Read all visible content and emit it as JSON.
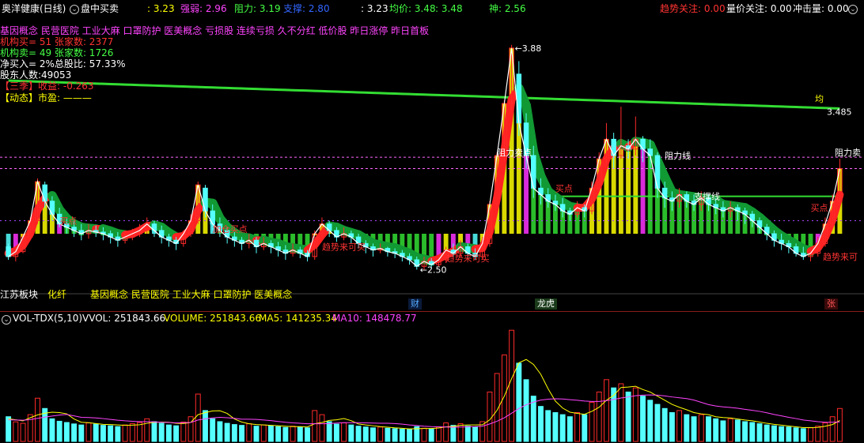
{
  "topbar": {
    "title": "奥洋健康(日线)",
    "menu_label": "盘中买卖",
    "price1": ": 3.23",
    "strength_label": "强弱: 2.96",
    "resistance_label": "阻力: 3.19",
    "support_label": "支撑: 2.80",
    "price2": ": 3.23",
    "avg_label": "均价: 3.48",
    "avg_value": ": 3.48",
    "god_label": "神: 2.56",
    "trend_label": "趋势关注: 0.00",
    "volume_price_label": "量价关注: 0.00",
    "impact_label": "冲击量: 0.00"
  },
  "colors": {
    "background": "#000000",
    "up": "#ff2a2a",
    "down": "#55ffff",
    "green_band": "#33dd33",
    "yellow": "#ffff00",
    "magenta": "#ff33ff",
    "white": "#ffffff"
  },
  "info_lines": {
    "concepts": "基因概念 民营医院 工业大麻 口罩防护 医美概念 亏损股 连续亏损 久不分红 低价股 昨日涨停 昨日首板",
    "inst_buy": "机构买= 51 张家数:  2377",
    "inst_sell": "机构卖= 49 张家数:  1726",
    "net_buy": "净买入= 2%总股比: 57.33%",
    "holders": "股东人数:49053",
    "three_season": "【三季】收益: -0.263",
    "dynamic": "【动态】市盈: ———"
  },
  "chart_labels": {
    "high_price": "3.88",
    "low_price": "2.50",
    "avg_right": "均",
    "avg_value": "3.485",
    "resistance_sell": "阻力卖",
    "resist_point": "阻力卖点",
    "pressure_line": "阻力线",
    "support_line": "支撑线",
    "trend_buy_1": "趋势来可买",
    "trend_buy_2": "趋势来可买",
    "trend_buy_3": "趋势来可",
    "buy_point_1": "买点",
    "buy_point_2": "买点",
    "red_buy": "加仓买点",
    "sell_tag": "买点"
  },
  "bottom_info": {
    "sector": "江苏板块",
    "industry": "化纤",
    "concepts": "基因概念 民营医院 工业大麻 口罩防护 医美概念"
  },
  "markers": [
    {
      "label": "财",
      "color": "#55aaff"
    },
    {
      "label": "龙虎",
      "color": "#ffffff"
    },
    {
      "label": "张",
      "color": "#ff5555"
    }
  ],
  "volume": {
    "indicator": "VOL-TDX(5,10)",
    "vvol": "VVOL: 251843.66",
    "volume": "VOLUME: 251843.66",
    "ma5": "MA5: 141235.34",
    "ma10": "MA10: 148478.77"
  },
  "chart_data": {
    "type": "candlestick",
    "candles": [
      [
        2.64,
        2.58,
        2.66,
        2.56
      ],
      [
        2.58,
        2.61,
        2.64,
        2.55
      ],
      [
        2.61,
        2.7,
        2.72,
        2.6
      ],
      [
        2.7,
        2.8,
        2.82,
        2.68
      ],
      [
        2.8,
        3.04,
        3.06,
        2.78
      ],
      [
        3.02,
        2.92,
        3.04,
        2.88
      ],
      [
        2.92,
        2.84,
        2.95,
        2.8
      ],
      [
        2.84,
        2.78,
        2.88,
        2.76
      ],
      [
        2.78,
        2.76,
        2.82,
        2.72
      ],
      [
        2.76,
        2.74,
        2.8,
        2.7
      ],
      [
        2.74,
        2.72,
        2.78,
        2.68
      ],
      [
        2.72,
        2.74,
        2.78,
        2.69
      ],
      [
        2.74,
        2.73,
        2.77,
        2.7
      ],
      [
        2.73,
        2.72,
        2.76,
        2.68
      ],
      [
        2.72,
        2.7,
        2.74,
        2.66
      ],
      [
        2.7,
        2.68,
        2.73,
        2.64
      ],
      [
        2.68,
        2.7,
        2.74,
        2.66
      ],
      [
        2.7,
        2.72,
        2.75,
        2.68
      ],
      [
        2.72,
        2.74,
        2.78,
        2.7
      ],
      [
        2.74,
        2.78,
        2.82,
        2.72
      ],
      [
        2.78,
        2.74,
        2.8,
        2.7
      ],
      [
        2.74,
        2.7,
        2.77,
        2.66
      ],
      [
        2.7,
        2.68,
        2.72,
        2.64
      ],
      [
        2.68,
        2.66,
        2.7,
        2.62
      ],
      [
        2.66,
        2.72,
        2.74,
        2.64
      ],
      [
        2.72,
        2.8,
        2.84,
        2.7
      ],
      [
        2.8,
        3.02,
        3.04,
        2.78
      ],
      [
        3.0,
        2.86,
        3.02,
        2.82
      ],
      [
        2.86,
        2.78,
        2.9,
        2.74
      ],
      [
        2.78,
        2.74,
        2.82,
        2.7
      ],
      [
        2.74,
        2.7,
        2.76,
        2.66
      ],
      [
        2.7,
        2.68,
        2.73,
        2.64
      ],
      [
        2.68,
        2.66,
        2.7,
        2.62
      ],
      [
        2.66,
        2.68,
        2.72,
        2.63
      ],
      [
        2.68,
        2.64,
        2.7,
        2.6
      ],
      [
        2.64,
        2.66,
        2.7,
        2.62
      ],
      [
        2.66,
        2.64,
        2.68,
        2.6
      ],
      [
        2.64,
        2.62,
        2.67,
        2.58
      ],
      [
        2.62,
        2.6,
        2.65,
        2.56
      ],
      [
        2.6,
        2.62,
        2.66,
        2.58
      ],
      [
        2.62,
        2.6,
        2.64,
        2.57
      ],
      [
        2.6,
        2.58,
        2.62,
        2.55
      ],
      [
        2.58,
        2.72,
        2.74,
        2.56
      ],
      [
        2.72,
        2.78,
        2.82,
        2.7
      ],
      [
        2.78,
        2.74,
        2.8,
        2.7
      ],
      [
        2.74,
        2.7,
        2.76,
        2.67
      ],
      [
        2.7,
        2.72,
        2.76,
        2.68
      ],
      [
        2.72,
        2.7,
        2.74,
        2.66
      ],
      [
        2.7,
        2.66,
        2.72,
        2.63
      ],
      [
        2.66,
        2.64,
        2.68,
        2.6
      ],
      [
        2.64,
        2.62,
        2.66,
        2.58
      ],
      [
        2.62,
        2.63,
        2.66,
        2.6
      ],
      [
        2.63,
        2.61,
        2.64,
        2.58
      ],
      [
        2.61,
        2.6,
        2.63,
        2.57
      ],
      [
        2.6,
        2.58,
        2.62,
        2.55
      ],
      [
        2.58,
        2.56,
        2.6,
        2.53
      ],
      [
        2.56,
        2.52,
        2.58,
        2.5
      ],
      [
        2.52,
        2.55,
        2.58,
        2.5
      ],
      [
        2.55,
        2.53,
        2.57,
        2.51
      ],
      [
        2.53,
        2.56,
        2.58,
        2.52
      ],
      [
        2.56,
        2.62,
        2.64,
        2.54
      ],
      [
        2.62,
        2.6,
        2.66,
        2.58
      ],
      [
        2.6,
        2.64,
        2.68,
        2.58
      ],
      [
        2.64,
        2.6,
        2.66,
        2.57
      ],
      [
        2.6,
        2.58,
        2.63,
        2.56
      ],
      [
        2.58,
        2.66,
        2.7,
        2.56
      ],
      [
        2.66,
        2.9,
        2.92,
        2.64
      ],
      [
        2.9,
        3.2,
        3.22,
        2.88
      ],
      [
        3.2,
        3.52,
        3.54,
        3.16
      ],
      [
        3.52,
        3.86,
        3.88,
        3.48
      ],
      [
        3.7,
        3.4,
        3.78,
        3.32
      ],
      [
        3.4,
        3.2,
        3.46,
        3.12
      ],
      [
        3.2,
        3.0,
        3.26,
        2.94
      ],
      [
        3.0,
        2.96,
        3.06,
        2.9
      ],
      [
        2.96,
        2.92,
        3.0,
        2.88
      ],
      [
        2.92,
        2.9,
        2.96,
        2.86
      ],
      [
        2.9,
        2.86,
        2.94,
        2.82
      ],
      [
        2.86,
        2.84,
        2.88,
        2.8
      ],
      [
        2.84,
        2.88,
        2.92,
        2.82
      ],
      [
        2.88,
        2.86,
        2.9,
        2.82
      ],
      [
        2.86,
        3.0,
        3.04,
        2.84
      ],
      [
        3.0,
        3.18,
        3.22,
        2.98
      ],
      [
        3.18,
        3.3,
        3.4,
        3.14
      ],
      [
        3.3,
        3.2,
        3.34,
        3.12
      ],
      [
        3.2,
        3.26,
        3.5,
        3.18
      ],
      [
        3.26,
        3.24,
        3.3,
        3.18
      ],
      [
        3.24,
        3.3,
        3.44,
        3.2
      ],
      [
        3.3,
        3.24,
        3.32,
        3.16
      ],
      [
        3.24,
        3.2,
        3.3,
        3.12
      ],
      [
        3.2,
        3.0,
        3.22,
        2.94
      ],
      [
        3.0,
        2.94,
        3.04,
        2.88
      ],
      [
        2.94,
        2.92,
        2.98,
        2.86
      ],
      [
        2.92,
        2.96,
        3.0,
        2.88
      ],
      [
        2.96,
        2.92,
        2.98,
        2.88
      ],
      [
        2.92,
        2.9,
        2.96,
        2.86
      ],
      [
        2.9,
        2.94,
        2.98,
        2.86
      ],
      [
        2.94,
        2.9,
        2.96,
        2.86
      ],
      [
        2.9,
        2.88,
        2.94,
        2.84
      ],
      [
        2.88,
        2.86,
        2.92,
        2.82
      ],
      [
        2.86,
        2.88,
        2.92,
        2.82
      ],
      [
        2.88,
        2.86,
        2.9,
        2.8
      ],
      [
        2.86,
        2.84,
        2.88,
        2.78
      ],
      [
        2.84,
        2.8,
        2.86,
        2.76
      ],
      [
        2.8,
        2.76,
        2.82,
        2.72
      ],
      [
        2.76,
        2.72,
        2.78,
        2.68
      ],
      [
        2.72,
        2.68,
        2.74,
        2.64
      ],
      [
        2.68,
        2.66,
        2.72,
        2.62
      ],
      [
        2.66,
        2.64,
        2.68,
        2.6
      ],
      [
        2.64,
        2.6,
        2.66,
        2.58
      ],
      [
        2.6,
        2.58,
        2.64,
        2.56
      ],
      [
        2.58,
        2.6,
        2.62,
        2.55
      ],
      [
        2.6,
        2.66,
        2.7,
        2.58
      ],
      [
        2.66,
        2.78,
        2.82,
        2.64
      ],
      [
        2.78,
        2.92,
        2.96,
        2.76
      ],
      [
        2.92,
        3.12,
        3.18,
        2.9
      ]
    ],
    "volumes": [
      120,
      95,
      88,
      130,
      210,
      160,
      110,
      98,
      92,
      85,
      80,
      90,
      84,
      78,
      76,
      72,
      80,
      86,
      92,
      110,
      96,
      88,
      80,
      76,
      94,
      120,
      230,
      150,
      110,
      96,
      88,
      82,
      78,
      86,
      74,
      80,
      76,
      72,
      68,
      74,
      70,
      66,
      150,
      130,
      96,
      84,
      90,
      80,
      74,
      70,
      66,
      70,
      64,
      62,
      60,
      58,
      72,
      64,
      60,
      70,
      90,
      78,
      86,
      74,
      70,
      96,
      240,
      330,
      420,
      540,
      380,
      300,
      220,
      170,
      150,
      140,
      130,
      120,
      140,
      130,
      190,
      240,
      300,
      260,
      280,
      240,
      260,
      220,
      200,
      180,
      160,
      140,
      150,
      130,
      120,
      130,
      120,
      110,
      100,
      110,
      104,
      96,
      92,
      86,
      80,
      76,
      72,
      70,
      66,
      62,
      66,
      74,
      90,
      120,
      160
    ],
    "ma5": [
      110,
      105,
      100,
      115,
      129,
      137,
      142,
      140,
      134,
      109,
      93,
      91,
      87,
      83,
      82,
      80,
      78,
      79,
      81,
      88,
      93,
      94,
      93,
      88,
      87,
      92,
      130,
      140,
      148,
      149,
      136,
      109,
      94,
      86,
      82,
      80,
      78,
      76,
      74,
      72,
      72,
      70,
      86,
      92,
      102,
      105,
      111,
      101,
      85,
      80,
      76,
      72,
      69,
      66,
      64,
      61,
      62,
      63,
      63,
      65,
      71,
      73,
      78,
      80,
      80,
      81,
      105,
      151,
      220,
      305,
      382,
      398,
      374,
      326,
      256,
      196,
      162,
      142,
      136,
      132,
      146,
      166,
      200,
      224,
      262,
      264,
      268,
      252,
      240,
      220,
      200,
      180,
      166,
      154,
      140,
      134,
      130,
      120,
      116,
      114,
      109,
      104,
      100,
      94,
      88,
      83,
      79,
      75,
      71,
      67,
      67,
      68,
      74,
      82,
      102
    ],
    "ma10": [
      105,
      104,
      103,
      106,
      112,
      118,
      123,
      128,
      131,
      124,
      117,
      116,
      114,
      111,
      107,
      103,
      100,
      98,
      96,
      96,
      95,
      93,
      92,
      90,
      91,
      92,
      104,
      110,
      114,
      117,
      115,
      112,
      108,
      108,
      107,
      104,
      101,
      97,
      93,
      90,
      88,
      86,
      86,
      86,
      87,
      89,
      91,
      91,
      91,
      90,
      89,
      88,
      88,
      87,
      84,
      80,
      77,
      74,
      72,
      71,
      70,
      69,
      70,
      71,
      72,
      74,
      85,
      98,
      115,
      137,
      160,
      178,
      191,
      201,
      205,
      207,
      206,
      203,
      200,
      196,
      194,
      194,
      198,
      204,
      211,
      216,
      222,
      225,
      226,
      225,
      221,
      216,
      212,
      208,
      201,
      190,
      179,
      172,
      168,
      165,
      161,
      156,
      151,
      146,
      139,
      131,
      124,
      117,
      111,
      104,
      100,
      96,
      93,
      93,
      95
    ]
  }
}
